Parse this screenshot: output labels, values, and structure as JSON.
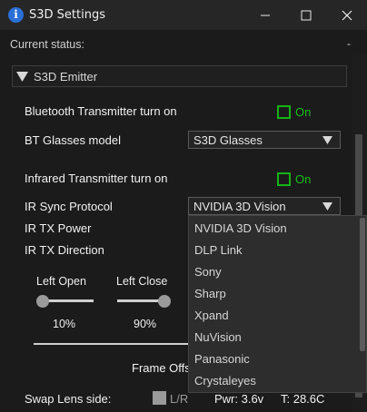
{
  "window": {
    "title": "S3D Settings",
    "icon": "info-icon",
    "controls": [
      "minimize-icon",
      "maximize-icon",
      "close-icon"
    ]
  },
  "status": {
    "label": "Current status:",
    "value": "-"
  },
  "section": {
    "label": "S3D Emitter",
    "expanded": true
  },
  "bluetooth": {
    "transmitter_label": "Bluetooth Transmitter turn on",
    "transmitter_check_label": "On",
    "glasses_model_label": "BT Glasses model",
    "glasses_model_value": "S3D Glasses"
  },
  "infrared": {
    "transmitter_label": "Infrared Transmitter turn on",
    "transmitter_check_label": "On",
    "sync_protocol_label": "IR Sync Protocol",
    "sync_protocol_value": "NVIDIA 3D Vision",
    "tx_power_label": "IR TX Power",
    "tx_direction_label": "IR TX Direction"
  },
  "dropdown": {
    "options": [
      "NVIDIA 3D Vision",
      "DLP Link",
      "Sony",
      "Sharp",
      "Xpand",
      "NuVision",
      "Panasonic",
      "Crystaleyes"
    ]
  },
  "sliders": {
    "left_open": {
      "label": "Left   Open",
      "value": "10%",
      "level": 0.1
    },
    "left_close": {
      "label": "Left   Close",
      "value": "90%",
      "level": 0.9
    }
  },
  "frame_offset": {
    "label": "Frame Offs"
  },
  "bottom": {
    "swap_lens_label": "Swap Lens side:",
    "swap_lens_value": "L/R",
    "power": "Pwr: 3.6v",
    "temp": "T: 28.6C"
  },
  "colors": {
    "accent_green": "#19c219",
    "background": "#1b1b1b",
    "titlebar": "#262626"
  }
}
